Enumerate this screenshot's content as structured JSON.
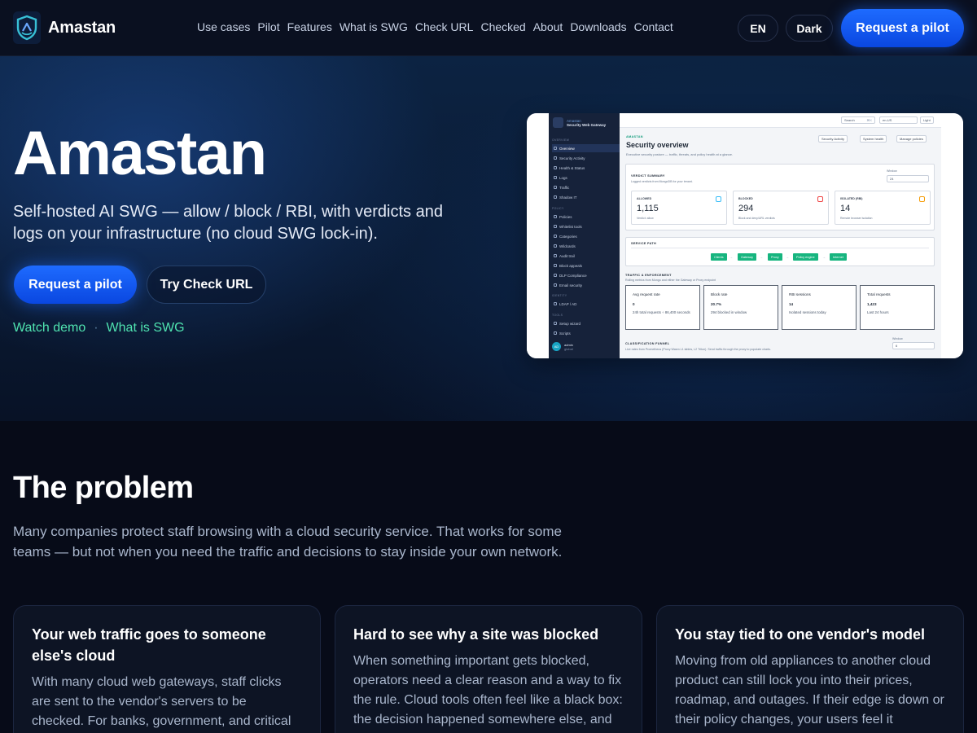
{
  "brand": {
    "name": "Amastan"
  },
  "nav": [
    "Use cases",
    "Pilot",
    "Features",
    "What is SWG",
    "Check URL",
    "Checked",
    "About",
    "Downloads",
    "Contact"
  ],
  "header_actions": {
    "lang": "EN",
    "theme": "Dark",
    "cta": "Request a pilot"
  },
  "hero": {
    "title": "Amastan",
    "subtitle": "Self-hosted AI SWG — allow / block / RBI, with verdicts and logs on your infrastructure (no cloud SWG lock-in).",
    "primary_cta": "Request a pilot",
    "secondary_cta": "Try Check URL",
    "link_demo": "Watch demo",
    "link_sep": "·",
    "link_swg": "What is SWG"
  },
  "mock": {
    "app_name": "Amastan",
    "app_sub": "Security Web Gateway",
    "sections": {
      "overview": "OVERVIEW",
      "policy": "POLICY",
      "identity": "IDENTITY",
      "tools": "TOOLS"
    },
    "nav_overview": [
      "Overview",
      "Security Activity",
      "Health & Status",
      "Logs",
      "Traffic",
      "Shadow IT"
    ],
    "nav_policy": [
      "Policies",
      "Whitelist tools",
      "Categories",
      "Wildcards",
      "Audit trail",
      "Block appeals",
      "DLP Compliance",
      "Email security"
    ],
    "nav_identity": [
      "LDAP / AD"
    ],
    "nav_tools": [
      "Setup wizard",
      "Scripts"
    ],
    "user_name": "admin",
    "user_role": "global",
    "user_initials": "AD",
    "search": "Search",
    "search_kbd": "⌘K",
    "lang": "en-US",
    "theme": "Light",
    "crumb": "AMASTAN",
    "title": "Security overview",
    "desc": "Executive security posture — traffic, threats, and policy health at a glance.",
    "actions": [
      "Security Activity",
      "System health",
      "Manage policies"
    ],
    "verdict": {
      "label": "VERDICT SUMMARY",
      "sub": "Logged verdicts from MongoDB for your tenant.",
      "window_label": "Window",
      "window_value": "24",
      "cards": [
        {
          "label": "ALLOWED",
          "value": "1,115",
          "sub": "Verdict: allow"
        },
        {
          "label": "BLOCKED",
          "value": "294",
          "sub": "Block and deny/URL verdicts"
        },
        {
          "label": "ISOLATED (RBI)",
          "value": "14",
          "sub": "Remote browser isolation"
        }
      ]
    },
    "service_path": {
      "label": "SERVICE PATH",
      "steps": [
        "Clients",
        "Gateway",
        "Proxy",
        "Policy engine",
        "Internet"
      ],
      "sep": "→"
    },
    "traffic": {
      "label": "TRAFFIC & ENFORCEMENT",
      "sub": "Rolling metrics from Mongo and either the Gateway or Proxy endpoint",
      "cards": [
        {
          "label": "Avg request rate",
          "value": "0",
          "sub": "24h total requests ÷ 86,400 seconds"
        },
        {
          "label": "Block rate",
          "value": "20.7%",
          "sub": "294 blocked in window"
        },
        {
          "label": "RBI sessions",
          "value": "14",
          "sub": "Isolated sessions today"
        },
        {
          "label": "Total requests",
          "value": "1,423",
          "sub": "Last 24 hours"
        }
      ]
    },
    "funnel": {
      "label": "CLASSIFICATION FUNNEL",
      "sub": "Live rates from Prometheus (Proxy Wasm L1 tables, L2 Triton). Send traffic through the proxy to populate charts.",
      "window_label": "Window",
      "window_value": "6"
    }
  },
  "problem": {
    "title": "The problem",
    "text": "Many companies protect staff browsing with a cloud security service. That works for some teams — but not when you need the traffic and decisions to stay inside your own network.",
    "cards": [
      {
        "title": "Your web traffic goes to someone else's cloud",
        "body": "With many cloud web gateways, staff clicks are sent to the vendor's servers to be checked. For banks, government, and critical"
      },
      {
        "title": "Hard to see why a site was blocked",
        "body": "When something important gets blocked, operators need a clear reason and a way to fix the rule. Cloud tools often feel like a black box: the decision happened somewhere else, and"
      },
      {
        "title": "You stay tied to one vendor's model",
        "body": "Moving from old appliances to another cloud product can still lock you into their prices, roadmap, and outages. If their edge is down or their policy changes, your users feel it"
      }
    ]
  },
  "colors": {
    "accent": "#1e6bff",
    "link": "#4fe3b0",
    "background": "#070b18"
  }
}
